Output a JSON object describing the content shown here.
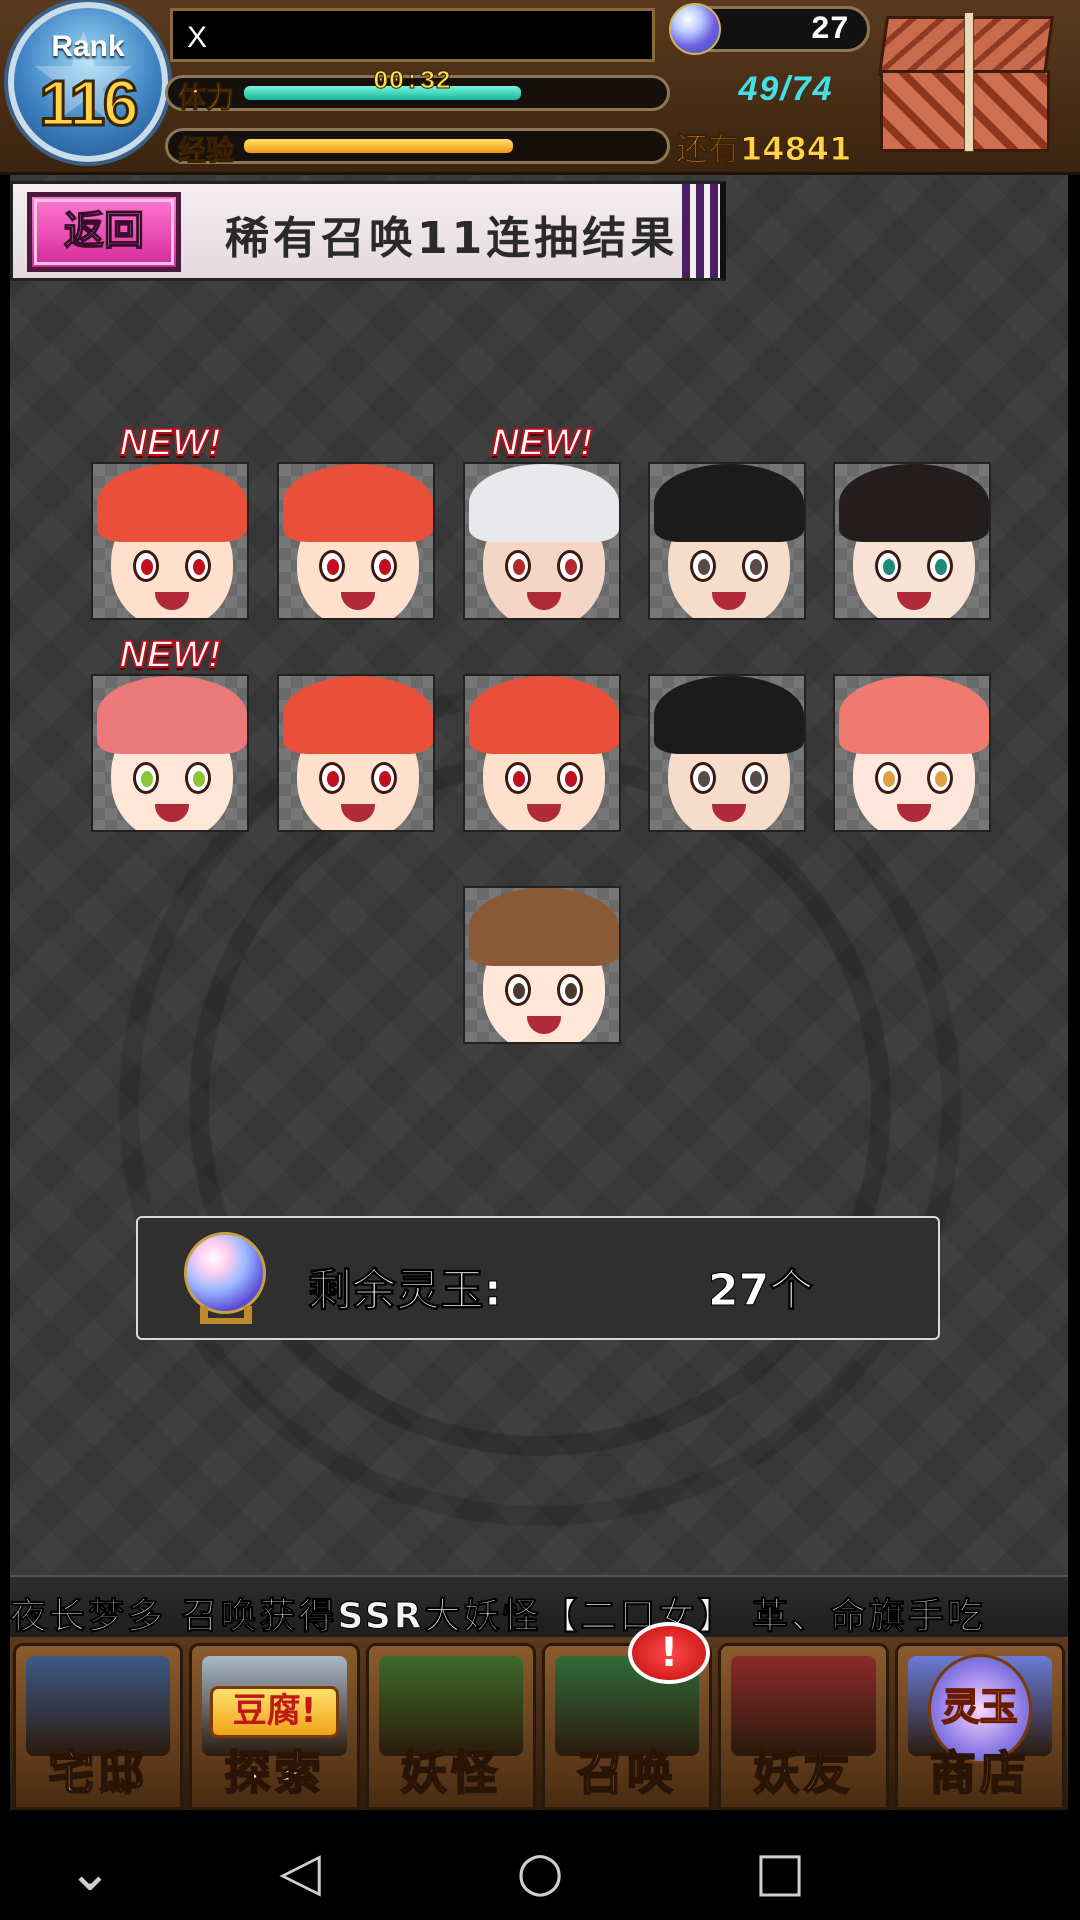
{
  "header": {
    "rank_label": "Rank",
    "rank_value": "116",
    "player_name": "X",
    "stamina_label": "体力",
    "stamina_timer": "00:32",
    "stamina_value": "49/74",
    "stamina_fraction": 0.66,
    "exp_label": "经验",
    "exp_remaining": "还有14841",
    "exp_fraction": 0.64,
    "orb_count": "27"
  },
  "banner": {
    "back_label": "返回",
    "title": "稀有召唤11连抽结果"
  },
  "results": [
    {
      "new": true,
      "new_label": "NEW!",
      "hair": "#e8503a",
      "iris": "#c01020",
      "skin": "#ffe0cc"
    },
    {
      "new": false,
      "hair": "#e8503a",
      "iris": "#c01020",
      "skin": "#ffe0cc"
    },
    {
      "new": true,
      "new_label": "NEW!",
      "hair": "#e8e8ec",
      "iris": "#b0282a",
      "skin": "#f3d6c6"
    },
    {
      "new": false,
      "hair": "#1b1b1b",
      "iris": "#5a4a48",
      "skin": "#f6dccb"
    },
    {
      "new": false,
      "hair": "#231d1d",
      "iris": "#1f8a78",
      "skin": "#f8e2d4"
    },
    {
      "new": true,
      "new_label": "NEW!",
      "hair": "#ec7a7a",
      "iris": "#8cc43a",
      "skin": "#ffe6d6"
    },
    {
      "new": false,
      "hair": "#e8503a",
      "iris": "#c01020",
      "skin": "#ffe0cc"
    },
    {
      "new": false,
      "hair": "#e8503a",
      "iris": "#c01020",
      "skin": "#ffe0cc"
    },
    {
      "new": false,
      "hair": "#1b1b1b",
      "iris": "#5a4a48",
      "skin": "#f6dccb"
    },
    {
      "new": false,
      "hair": "#f07a70",
      "iris": "#e0a040",
      "skin": "#ffe6da"
    },
    {
      "new": false,
      "hair": "#8a5a36",
      "iris": "#4a3a30",
      "skin": "#ffe6d6"
    }
  ],
  "remaining": {
    "label": "剩余灵玉:",
    "value": "27个"
  },
  "ticker": "夜长梦多 召唤获得SSR大妖怪【二口女】   革、命旗手吃",
  "nav": [
    {
      "label": "宅邸",
      "icon": "mansion-icon",
      "tag": ""
    },
    {
      "label": "探索",
      "icon": "explore-icon",
      "tag": "豆腐!"
    },
    {
      "label": "妖怪",
      "icon": "scroll-icon",
      "tag": ""
    },
    {
      "label": "召唤",
      "icon": "pentagram-icon",
      "tag": ""
    },
    {
      "label": "妖友",
      "icon": "friend-icon",
      "tag": ""
    },
    {
      "label": "商店",
      "icon": "orb-shop-icon",
      "tag": "灵玉"
    }
  ],
  "notify_badge": "!",
  "system_nav": {
    "collapse": "⌄",
    "back": "◁",
    "home": "○",
    "recent": "□"
  },
  "colors": {
    "accent_pink": "#d4289a",
    "stamina": "#14b89c",
    "exp": "#f29a12",
    "stamina_text": "#43e0e5",
    "gold_text": "#ffd34a"
  }
}
